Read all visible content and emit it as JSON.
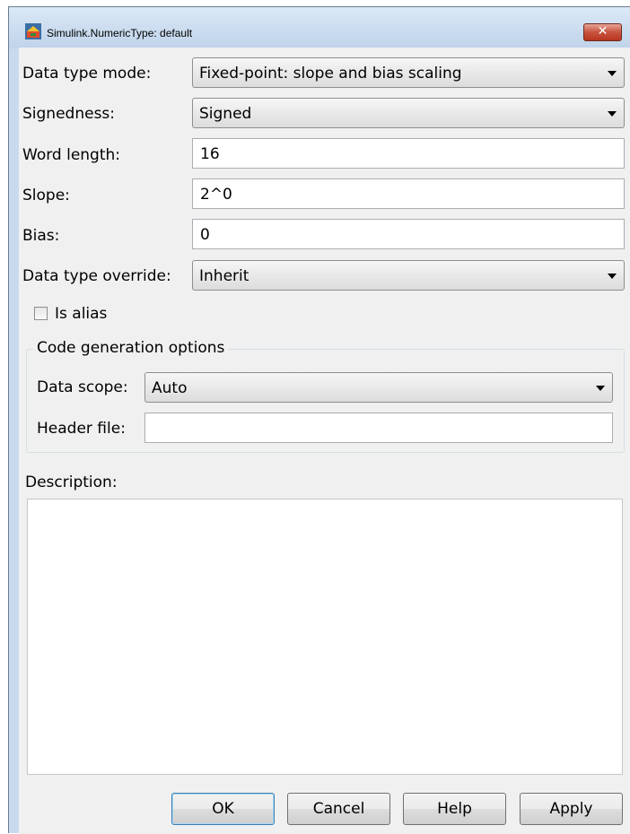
{
  "window": {
    "title": "Simulink.NumericType: default",
    "close_glyph": "✕",
    "icon": "simulink-icon"
  },
  "form": {
    "data_type_mode": {
      "label": "Data type mode:",
      "value": "Fixed-point: slope and bias scaling"
    },
    "signedness": {
      "label": "Signedness:",
      "value": "Signed"
    },
    "word_length": {
      "label": "Word length:",
      "value": "16"
    },
    "slope": {
      "label": "Slope:",
      "value": "2^0"
    },
    "bias": {
      "label": "Bias:",
      "value": "0"
    },
    "data_type_override": {
      "label": "Data type override:",
      "value": "Inherit"
    },
    "is_alias": {
      "label": "Is alias",
      "checked": false
    }
  },
  "code_generation": {
    "title": "Code generation options",
    "data_scope": {
      "label": "Data scope:",
      "value": "Auto"
    },
    "header_file": {
      "label": "Header file:",
      "value": ""
    }
  },
  "description": {
    "label": "Description:",
    "value": ""
  },
  "buttons": {
    "ok": "OK",
    "cancel": "Cancel",
    "help": "Help",
    "apply": "Apply"
  },
  "colors": {
    "title_bar": "#c9daee",
    "client_bg": "#f0f0f0",
    "close_button": "#c7533f"
  }
}
